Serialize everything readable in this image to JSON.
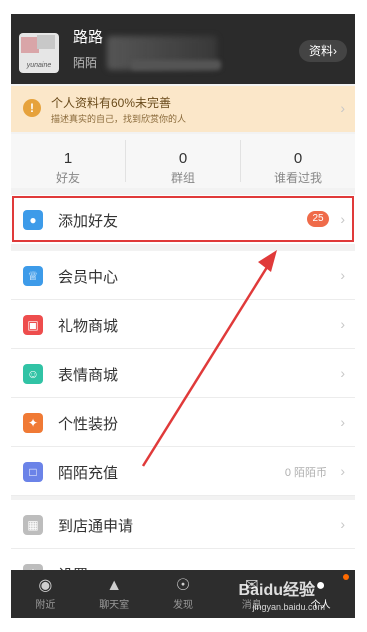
{
  "header": {
    "username": "路路",
    "subtitle": "陌陌",
    "avatar_brand": "yunaine",
    "profile_button": "资料",
    "profile_chevron": "›"
  },
  "notice": {
    "icon": "!",
    "title": "个人资料有60%未完善",
    "subtitle": "描述真实的自己，找到欣赏你的人"
  },
  "stats": [
    {
      "value": "1",
      "label": "好友"
    },
    {
      "value": "0",
      "label": "群组"
    },
    {
      "value": "0",
      "label": "谁看过我"
    }
  ],
  "menu_group1": [
    {
      "label": "添加好友",
      "badge": "25",
      "icon": "person-icon",
      "color": "#3d9be9"
    }
  ],
  "menu_group2": [
    {
      "label": "会员中心",
      "icon": "crown-icon",
      "color": "#3d9be9"
    },
    {
      "label": "礼物商城",
      "icon": "gift-icon",
      "color": "#ee4d4d"
    },
    {
      "label": "表情商城",
      "icon": "emoticon-icon",
      "color": "#31c3a5"
    },
    {
      "label": "个性装扮",
      "icon": "brush-icon",
      "color": "#f07a35"
    },
    {
      "label": "陌陌充值",
      "icon": "wallet-icon",
      "color": "#6b83e8",
      "right": "0 陌陌币"
    }
  ],
  "menu_group3": [
    {
      "label": "到店通申请",
      "icon": "store-icon",
      "color": "#bdbdbd"
    },
    {
      "label": "设置",
      "icon": "settings-icon",
      "color": "#bdbdbd"
    }
  ],
  "tabs": [
    {
      "label": "附近",
      "icon": "location-icon"
    },
    {
      "label": "聊天室",
      "icon": "chatroom-icon"
    },
    {
      "label": "发现",
      "icon": "discover-icon"
    },
    {
      "label": "消息",
      "icon": "message-icon"
    },
    {
      "label": "个人",
      "icon": "person-icon",
      "active": true
    }
  ],
  "watermark": {
    "text": "Baidu经验",
    "url": "jingyan.baidu.com"
  },
  "chevron": "›"
}
